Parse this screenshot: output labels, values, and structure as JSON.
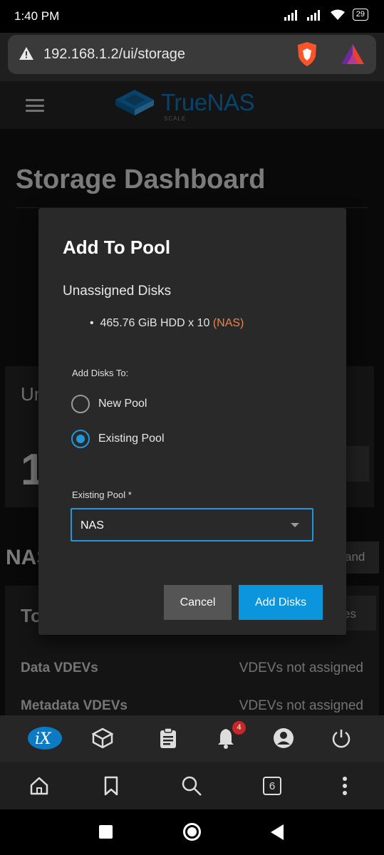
{
  "status_bar": {
    "time": "1:40 PM",
    "battery": "29"
  },
  "browser": {
    "url": "192.168.1.2/ui/storage",
    "open_tabs": "6"
  },
  "app": {
    "logo_text": "TrueNAS",
    "logo_sub": "SCALE",
    "notification_count": "4"
  },
  "page": {
    "title": "Storage Dashboard",
    "card_a_title": "Un",
    "card_a_number": "1",
    "card_a_button": "l",
    "section_title": "NAS",
    "expand_button": "and",
    "card_b_title": "To",
    "card_b_button": "es",
    "rows": [
      {
        "label": "Data VDEVs",
        "value": "VDEVs not assigned"
      },
      {
        "label": "Metadata VDEVs",
        "value": "VDEVs not assigned"
      }
    ]
  },
  "dialog": {
    "title": "Add To Pool",
    "subtitle": "Unassigned Disks",
    "disk_text": "465.76 GiB HDD x 10",
    "disk_pool": "(NAS)",
    "add_disks_to_label": "Add Disks To:",
    "options": [
      "New Pool",
      "Existing Pool"
    ],
    "selected_option": "Existing Pool",
    "existing_pool_label": "Existing Pool *",
    "existing_pool_value": "NAS",
    "cancel_label": "Cancel",
    "confirm_label": "Add Disks"
  },
  "colors": {
    "accent": "#0a95dd",
    "pool_tag": "#e8874a",
    "badge": "#c62828",
    "logo": "#0d7bc4"
  }
}
